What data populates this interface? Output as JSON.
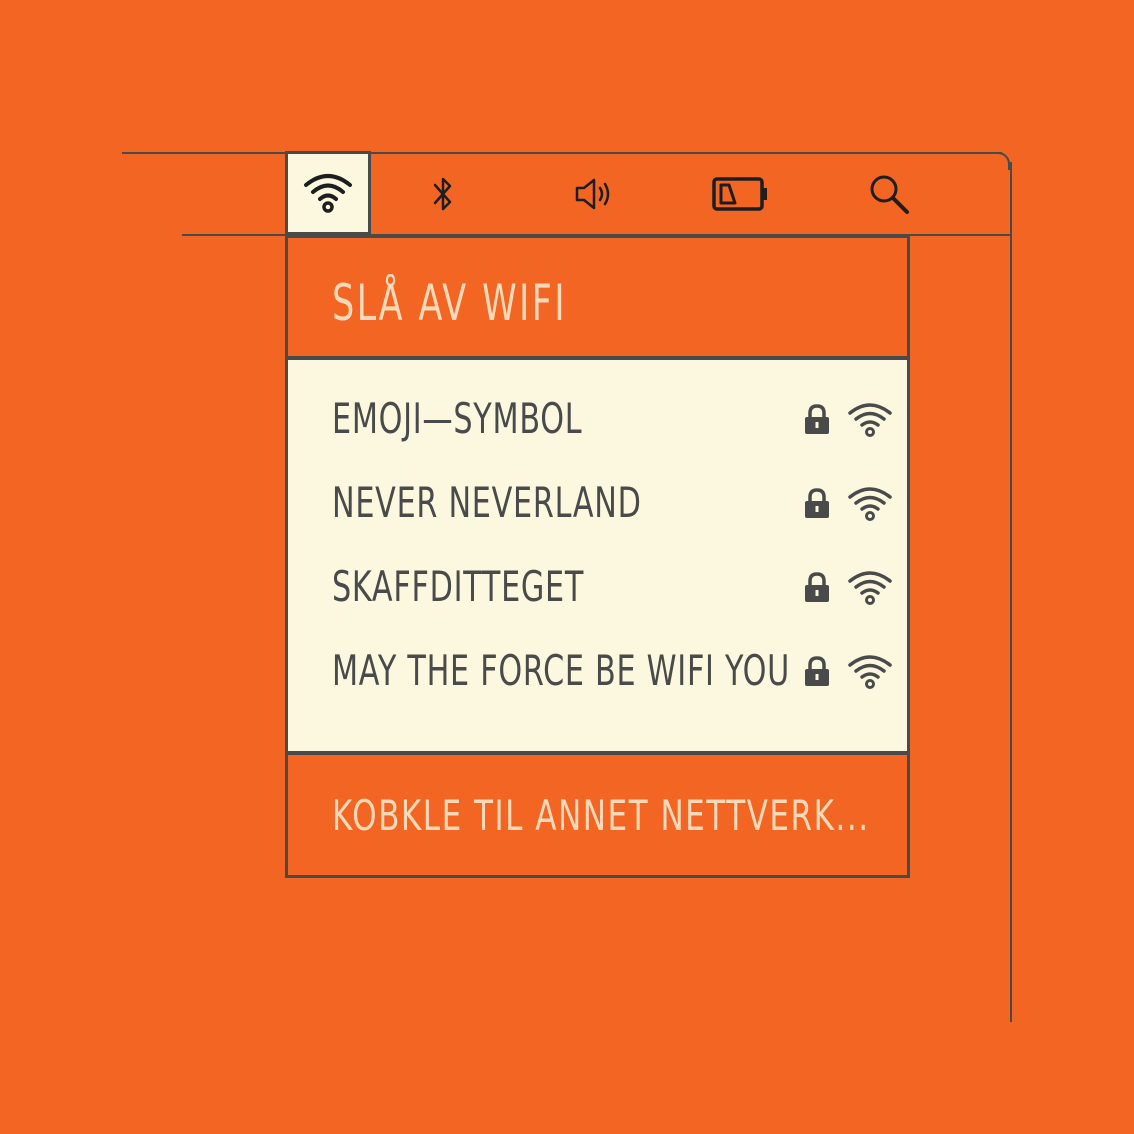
{
  "menubar": {
    "items": [
      {
        "icon": "wifi-icon",
        "active": true
      },
      {
        "icon": "bluetooth-icon",
        "active": false
      },
      {
        "icon": "speaker-icon",
        "active": false
      },
      {
        "icon": "battery-icon",
        "active": false
      },
      {
        "icon": "search-icon",
        "active": false
      }
    ]
  },
  "wifi_menu": {
    "toggle_label": "SLÅ AV WIFI",
    "networks": [
      {
        "name": "EMOJI—SYMBOL",
        "locked": true,
        "signal_icon": "wifi-icon"
      },
      {
        "name": "NEVER NEVERLAND",
        "locked": true,
        "signal_icon": "wifi-icon"
      },
      {
        "name": "SKAFFDITTEGET",
        "locked": true,
        "signal_icon": "wifi-icon"
      },
      {
        "name": "MAY THE FORCE BE WIFI YOU",
        "locked": true,
        "signal_icon": "wifi-icon"
      }
    ],
    "other_network_label": "KOBKLE TIL ANNET NETTVERK..."
  },
  "colors": {
    "background": "#f26522",
    "panel": "#fbf8df",
    "outline": "#4a4a4a",
    "light_text": "#fbd9b8"
  }
}
